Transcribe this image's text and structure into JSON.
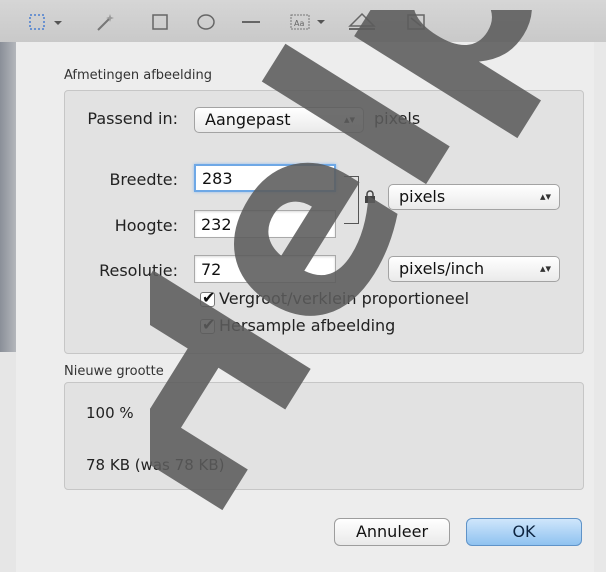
{
  "toolbar": {
    "icons": [
      "select-marquee-icon",
      "magic-wand-icon",
      "rectangle-icon",
      "ellipse-icon",
      "line-icon",
      "text-box-icon",
      "shape-style-icon",
      "resize-icon"
    ]
  },
  "size_section": {
    "title": "Afmetingen afbeelding",
    "fit_label": "Passend in:",
    "fit_value": "Aangepast",
    "fit_unit": "pixels",
    "width_label": "Breedte:",
    "width_value": "283",
    "height_label": "Hoogte:",
    "height_value": "232",
    "unit_value": "pixels",
    "resolution_label": "Resolutie:",
    "resolution_value": "72",
    "resolution_unit": "pixels/inch",
    "scale_proportional_label": "Vergroot/verklein proportioneel",
    "scale_proportional_checked": true,
    "resample_label": "Hersample afbeelding",
    "resample_checked": true
  },
  "new_size_section": {
    "title": "Nieuwe grootte",
    "percent": "100 %",
    "filesize": "78 KB (was 78 KB)"
  },
  "buttons": {
    "cancel": "Annuleer",
    "ok": "OK"
  },
  "watermark_text": "Help",
  "colors": {
    "accent": "#8fc2f0",
    "focus": "#6ea8e6"
  }
}
